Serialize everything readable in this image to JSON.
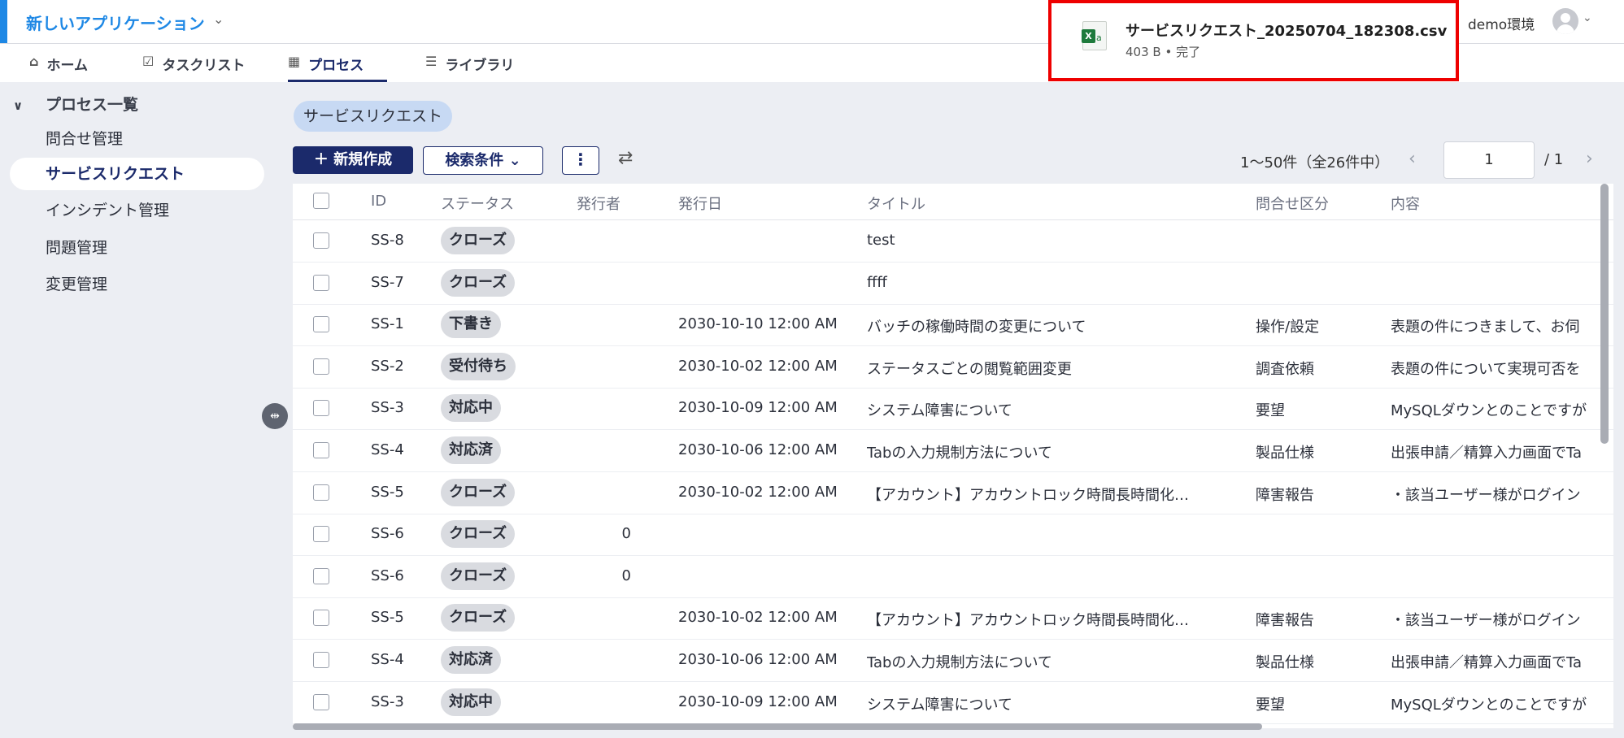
{
  "app": {
    "title": "新しいアプリケーション",
    "env": "demo環境"
  },
  "tabs": [
    {
      "label": "ホーム",
      "icon": "home-icon"
    },
    {
      "label": "タスクリスト",
      "icon": "checklist-icon"
    },
    {
      "label": "プロセス",
      "icon": "process-icon",
      "active": true
    },
    {
      "label": "ライブラリ",
      "icon": "library-icon"
    }
  ],
  "sidebar": {
    "header": "プロセス一覧",
    "items": [
      {
        "label": "問合せ管理"
      },
      {
        "label": "サービスリクエスト",
        "active": true
      },
      {
        "label": "インシデント管理"
      },
      {
        "label": "問題管理"
      },
      {
        "label": "変更管理"
      }
    ]
  },
  "main": {
    "chip": "サービスリクエスト",
    "new_button": "新規作成",
    "search_button": "検索条件",
    "more_button": "⋮",
    "pagination": {
      "range": "1〜50件（全26件中）",
      "page": "1",
      "total": "/ 1"
    }
  },
  "table": {
    "headers": [
      "ID",
      "ステータス",
      "発行者",
      "発行日",
      "タイトル",
      "問合せ区分",
      "内容"
    ],
    "rows": [
      {
        "id": "SS-8",
        "status": "クローズ",
        "issuer": "",
        "date": "",
        "title": "test",
        "category": "",
        "content": ""
      },
      {
        "id": "SS-7",
        "status": "クローズ",
        "issuer": "",
        "date": "",
        "title": "ffff",
        "category": "",
        "content": ""
      },
      {
        "id": "SS-1",
        "status": "下書き",
        "issuer": "",
        "date": "2030-10-10 12:00 AM",
        "title": "バッチの稼働時間の変更について",
        "category": "操作/設定",
        "content": "表題の件につきまして、お伺"
      },
      {
        "id": "SS-2",
        "status": "受付待ち",
        "issuer": "",
        "date": "2030-10-02 12:00 AM",
        "title": "ステータスごとの閲覧範囲変更",
        "category": "調査依頼",
        "content": "表題の件について実現可否を"
      },
      {
        "id": "SS-3",
        "status": "対応中",
        "issuer": "",
        "date": "2030-10-09 12:00 AM",
        "title": "システム障害について",
        "category": "要望",
        "content": "MySQLダウンとのことですが"
      },
      {
        "id": "SS-4",
        "status": "対応済",
        "issuer": "",
        "date": "2030-10-06 12:00 AM",
        "title": "Tabの入力規制方法について",
        "category": "製品仕様",
        "content": "出張申請／精算入力画面でTa"
      },
      {
        "id": "SS-5",
        "status": "クローズ",
        "issuer": "",
        "date": "2030-10-02 12:00 AM",
        "title": "【アカウント】アカウントロック時間長時間化…",
        "category": "障害報告",
        "content": "・該当ユーザー様がログイン"
      },
      {
        "id": "SS-6",
        "status": "クローズ",
        "issuer": "0",
        "date": "",
        "title": "",
        "category": "",
        "content": ""
      },
      {
        "id": "SS-6",
        "status": "クローズ",
        "issuer": "0",
        "date": "",
        "title": "",
        "category": "",
        "content": ""
      },
      {
        "id": "SS-5",
        "status": "クローズ",
        "issuer": "",
        "date": "2030-10-02 12:00 AM",
        "title": "【アカウント】アカウントロック時間長時間化…",
        "category": "障害報告",
        "content": "・該当ユーザー様がログイン"
      },
      {
        "id": "SS-4",
        "status": "対応済",
        "issuer": "",
        "date": "2030-10-06 12:00 AM",
        "title": "Tabの入力規制方法について",
        "category": "製品仕様",
        "content": "出張申請／精算入力画面でTa"
      },
      {
        "id": "SS-3",
        "status": "対応中",
        "issuer": "",
        "date": "2030-10-09 12:00 AM",
        "title": "システム障害について",
        "category": "要望",
        "content": "MySQLダウンとのことですが"
      }
    ]
  },
  "download": {
    "filename": "サービスリクエスト_20250704_182308.csv",
    "meta": "403 B • 完了",
    "icon": "excel-file-icon"
  },
  "colors": {
    "accent": "#1e88e5",
    "primary": "#1b2a6b",
    "highlight_border": "#ee0000"
  }
}
